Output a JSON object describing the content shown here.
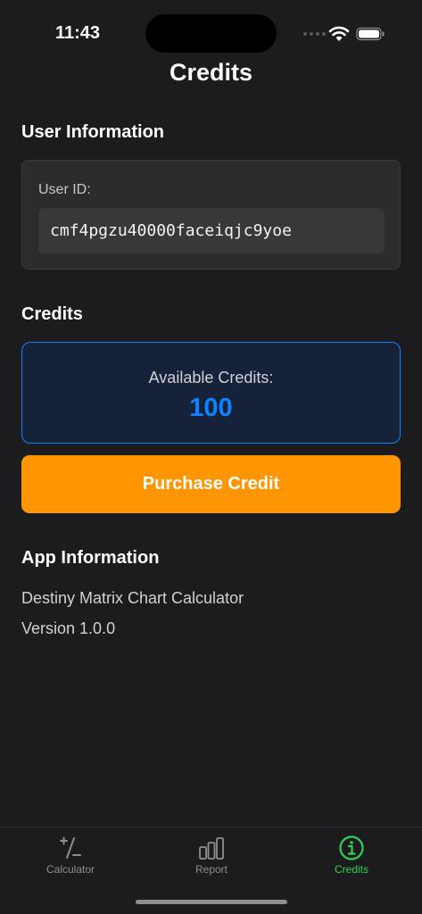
{
  "status": {
    "time": "11:43"
  },
  "header": {
    "title": "Credits"
  },
  "user_section": {
    "title": "User Information",
    "label": "User ID:",
    "user_id": "cmf4pgzu40000faceiqjc9yoe"
  },
  "credits_section": {
    "title": "Credits",
    "label": "Available Credits:",
    "value": "100",
    "purchase_label": "Purchase Credit"
  },
  "app_info": {
    "title": "App Information",
    "name": "Destiny Matrix Chart Calculator",
    "version": "Version 1.0.0"
  },
  "tabs": [
    {
      "label": "Calculator",
      "icon": "calculator-icon"
    },
    {
      "label": "Report",
      "icon": "chart-bars-icon"
    },
    {
      "label": "Credits",
      "icon": "info-icon"
    }
  ],
  "colors": {
    "background": "#1c1c1e",
    "accent_blue": "#0a84ff",
    "purchase_orange": "#ff9500",
    "active_tab": "#30d158"
  }
}
